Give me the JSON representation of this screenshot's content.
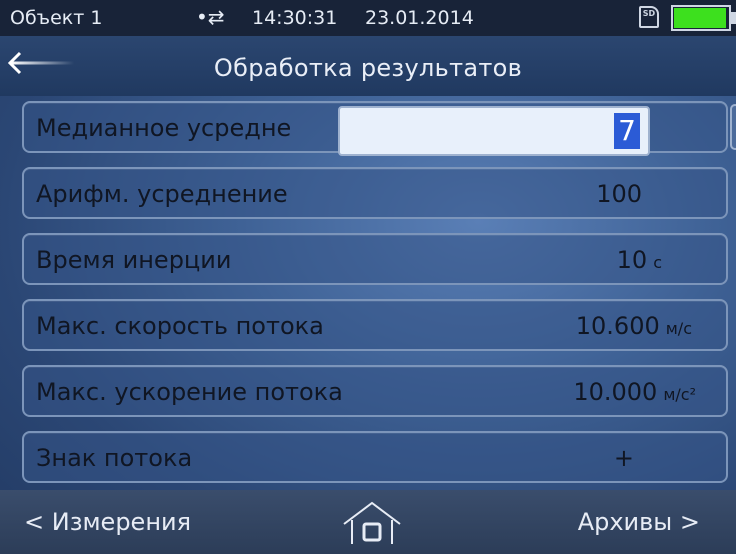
{
  "status": {
    "object": "Объект 1",
    "time": "14:30:31",
    "date": "23.01.2014",
    "icons": [
      "usb-icon",
      "sd-card-icon",
      "battery-icon"
    ],
    "battery_color": "#3de01e"
  },
  "header": {
    "title": "Обработка результатов",
    "back_icon": "back-arrow-icon"
  },
  "rows": [
    {
      "label": "Медианное усредне",
      "value": "",
      "unit": ""
    },
    {
      "label": "Арифм. усреднение",
      "value": "100",
      "unit": ""
    },
    {
      "label": "Время инерции",
      "value": "10",
      "unit": "с"
    },
    {
      "label": "Макс. скорость потока",
      "value": "10.600",
      "unit": "м/с"
    },
    {
      "label": "Макс. ускорение потока",
      "value": "10.000",
      "unit": "м/с²"
    },
    {
      "label": "Знак потока",
      "value": "+",
      "unit": ""
    }
  ],
  "editor": {
    "value": "7"
  },
  "footer": {
    "back_label": "< Измерения",
    "forward_label": "Архивы >",
    "home_icon": "home-icon"
  }
}
